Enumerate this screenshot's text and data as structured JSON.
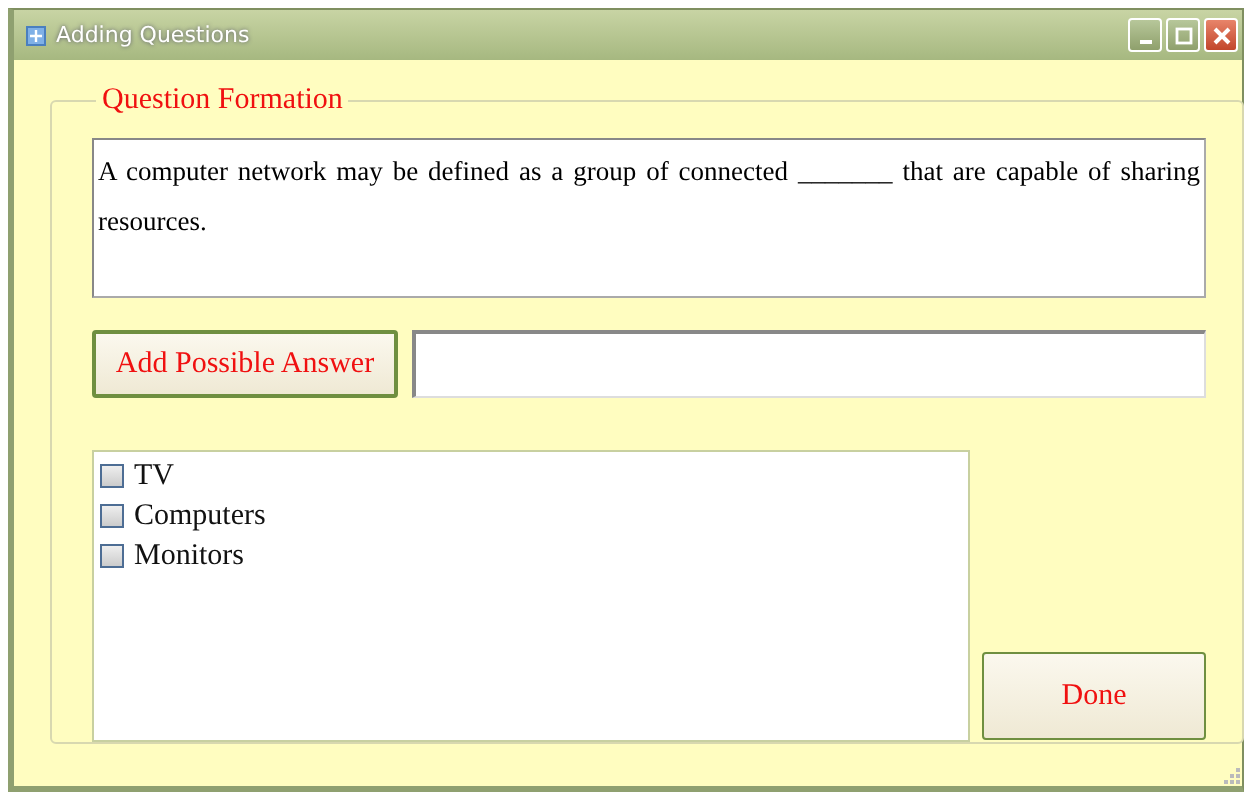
{
  "window": {
    "title": "Adding Questions"
  },
  "group": {
    "title": "Question Formation"
  },
  "question": {
    "value": "A computer network may be defined as a group of connected _______ that are capable of sharing resources."
  },
  "add_answer": {
    "button": "Add Possible Answer"
  },
  "answers": [
    {
      "label": "TV",
      "checked": false
    },
    {
      "label": "Computers",
      "checked": false
    },
    {
      "label": "Monitors",
      "checked": false
    }
  ],
  "done_button": "Done"
}
